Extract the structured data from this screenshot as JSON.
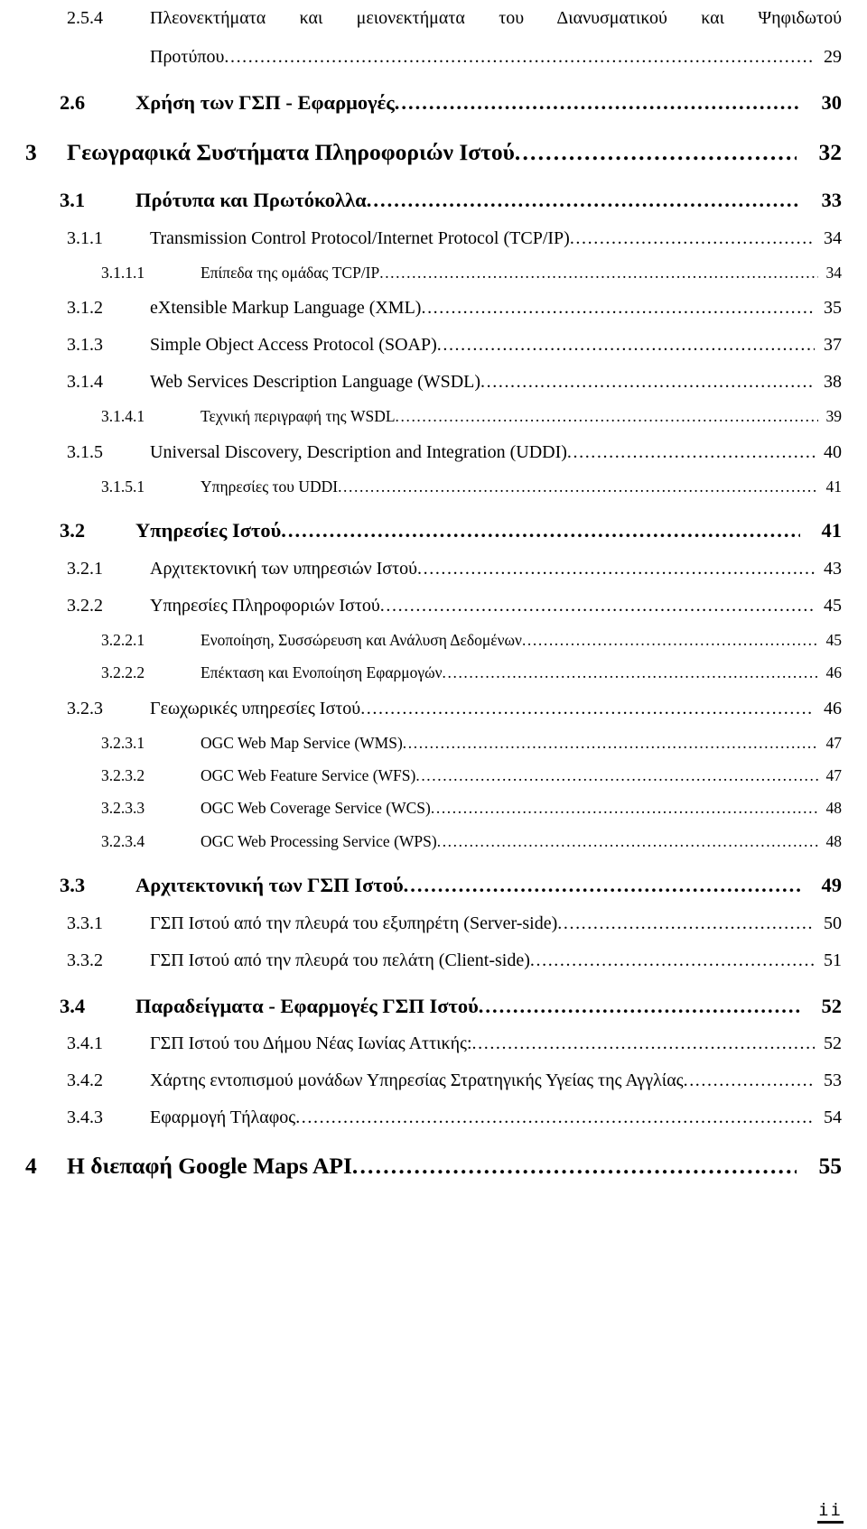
{
  "document": {
    "kind": "table-of-contents",
    "page_folio": "ii"
  },
  "entries": [
    {
      "level": 4,
      "number": "2.5.4",
      "title": "Πλεονεκτήματα και μειονεκτήματα του Διανυσματικού και Ψηφιδωτού",
      "title_line2": "Προτύπου",
      "page": "29",
      "wrapped": true
    },
    {
      "level": 2,
      "number": "2.6",
      "title": "Χρήση των ΓΣΠ - Εφαρμογές",
      "page": "30"
    },
    {
      "level": 1,
      "number": "3",
      "title": "Γεωγραφικά Συστήματα Πληροφοριών Ιστού",
      "page": "32"
    },
    {
      "level": 2,
      "number": "3.1",
      "title": "Πρότυπα και Πρωτόκολλα",
      "page": "33"
    },
    {
      "level": 3,
      "number": "3.1.1",
      "title": "Transmission Control Protocol/Internet Protocol (TCP/IP)",
      "page": "34"
    },
    {
      "level": 4,
      "number": "3.1.1.1",
      "title": "Επίπεδα της ομάδας TCP/IP",
      "page": "34"
    },
    {
      "level": 3,
      "number": "3.1.2",
      "title": "eXtensible Markup Language (XML)",
      "page": "35"
    },
    {
      "level": 3,
      "number": "3.1.3",
      "title": "Simple Object Access Protocol (SOAP)",
      "page": "37"
    },
    {
      "level": 3,
      "number": "3.1.4",
      "title": "Web Services Description Language (WSDL)",
      "page": "38"
    },
    {
      "level": 4,
      "number": "3.1.4.1",
      "title": "Τεχνική περιγραφή της WSDL",
      "page": "39"
    },
    {
      "level": 3,
      "number": "3.1.5",
      "title": "Universal Discovery, Description and Integration (UDDI)",
      "page": "40"
    },
    {
      "level": 4,
      "number": "3.1.5.1",
      "title": "Υπηρεσίες του UDDI",
      "page": "41"
    },
    {
      "level": 2,
      "number": "3.2",
      "title": "Υπηρεσίες Ιστού",
      "page": "41"
    },
    {
      "level": 3,
      "number": "3.2.1",
      "title": "Αρχιτεκτονική των υπηρεσιών Ιστού",
      "page": "43"
    },
    {
      "level": 3,
      "number": "3.2.2",
      "title": "Υπηρεσίες Πληροφοριών Ιστού",
      "page": "45"
    },
    {
      "level": 4,
      "number": "3.2.2.1",
      "title": "Ενοποίηση, Συσσώρευση και Ανάλυση Δεδομένων",
      "page": "45"
    },
    {
      "level": 4,
      "number": "3.2.2.2",
      "title": "Επέκταση και Ενοποίηση Εφαρμογών",
      "page": "46"
    },
    {
      "level": 3,
      "number": "3.2.3",
      "title": "Γεωχωρικές υπηρεσίες Ιστού",
      "page": "46"
    },
    {
      "level": 4,
      "number": "3.2.3.1",
      "title": "OGC Web Map Service (WMS)",
      "page": "47"
    },
    {
      "level": 4,
      "number": "3.2.3.2",
      "title": "OGC Web Feature Service (WFS)",
      "page": "47"
    },
    {
      "level": 4,
      "number": "3.2.3.3",
      "title": "OGC Web Coverage Service (WCS)",
      "page": "48"
    },
    {
      "level": 4,
      "number": "3.2.3.4",
      "title": "OGC Web Processing Service (WPS)",
      "page": "48"
    },
    {
      "level": 2,
      "number": "3.3",
      "title": "Αρχιτεκτονική των ΓΣΠ Ιστού",
      "page": "49"
    },
    {
      "level": 3,
      "number": "3.3.1",
      "title": "ΓΣΠ Ιστού από την πλευρά του εξυπηρέτη (Server-side)",
      "page": "50"
    },
    {
      "level": 3,
      "number": "3.3.2",
      "title": "ΓΣΠ Ιστού από την πλευρά του πελάτη (Client-side)",
      "page": "51"
    },
    {
      "level": 2,
      "number": "3.4",
      "title": "Παραδείγματα - Εφαρμογές ΓΣΠ Ιστού",
      "page": "52"
    },
    {
      "level": 3,
      "number": "3.4.1",
      "title": "ΓΣΠ Ιστού του Δήμου Νέας Ιωνίας Αττικής:",
      "page": "52"
    },
    {
      "level": 3,
      "number": "3.4.2",
      "title": "Χάρτης εντοπισμού μονάδων Υπηρεσίας Στρατηγικής Υγείας της Αγγλίας",
      "page": "53"
    },
    {
      "level": 3,
      "number": "3.4.3",
      "title": "Εφαρμογή Τήλαφος",
      "page": "54"
    },
    {
      "level": 1,
      "number": "4",
      "title": "Η διεπαφή Google Maps API",
      "page": "55"
    }
  ]
}
